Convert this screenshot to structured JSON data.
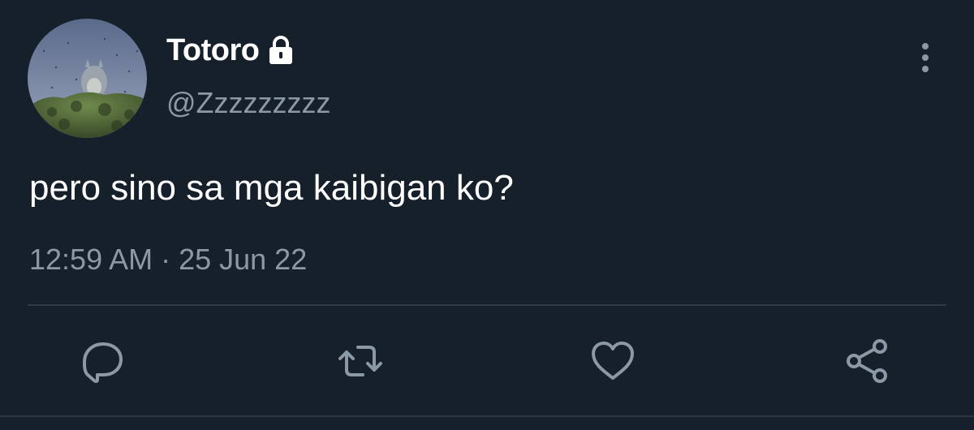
{
  "tweet": {
    "display_name": "Totoro",
    "handle": "@Zzzzzzzzz",
    "text": "pero sino sa mga kaibigan ko?",
    "timestamp": "12:59 AM · 25 Jun 22",
    "locked": true
  },
  "icons": {
    "lock": "lock-icon",
    "more": "vertical-ellipsis-icon",
    "reply": "speech-bubble-icon",
    "retweet": "retweet-arrows-icon",
    "like": "heart-icon",
    "share": "share-nodes-icon"
  },
  "colors": {
    "background": "#15202b",
    "primary_text": "#ffffff",
    "secondary_text": "#8b98a5",
    "divider": "#2f3b47"
  }
}
